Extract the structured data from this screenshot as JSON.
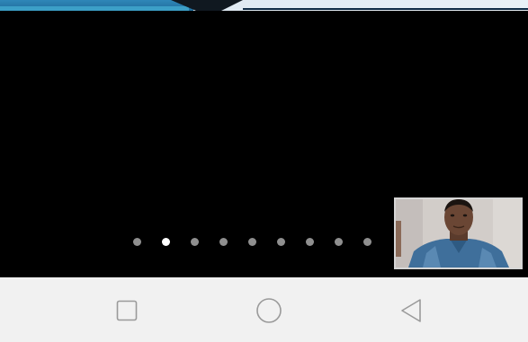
{
  "presentation": {
    "page_count": 9,
    "active_page": 2
  },
  "camera_preview": {
    "state": "live-self-view"
  },
  "navigation_bar": {
    "recent_icon": "square-icon",
    "home_icon": "circle-icon",
    "back_icon": "triangle-back-icon"
  },
  "colors": {
    "stage_background": "#000000",
    "navbar_background": "#f1f1f1",
    "dot_inactive": "#8f8f8f",
    "dot_active": "#ffffff"
  }
}
